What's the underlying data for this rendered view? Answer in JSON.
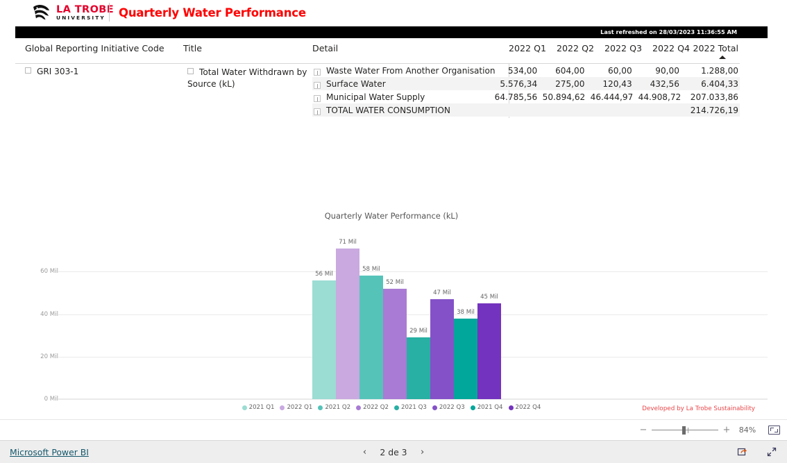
{
  "header": {
    "logo_main": "LA TROBE",
    "logo_sub": "UNIVERSITY",
    "title": "Quarterly Water Performance",
    "refresh_text": "Last refreshed on 28/03/2023 11:36:55 AM",
    "title_color": "#FF0000",
    "brand_red": "#E4002B"
  },
  "matrix": {
    "columns": [
      "Global Reporting Initiative Code",
      "Title",
      "Detail",
      "2022 Q1",
      "2022 Q2",
      "2022 Q3",
      "2022 Q4",
      "2022 Total"
    ],
    "sorted_column": "2022 Total",
    "sort_direction": "ascending",
    "gri_code": "GRI 303-1",
    "title_value": "Total Water Withdrawn by Source (kL)",
    "rows": [
      {
        "detail": "Waste Water From Another Organisation",
        "q1": "534,00",
        "q2": "604,00",
        "q3": "60,00",
        "q4": "90,00",
        "total": "1.288,00"
      },
      {
        "detail": "Surface Water",
        "q1": "5.576,34",
        "q2": "275,00",
        "q3": "120,43",
        "q4": "432,56",
        "total": "6.404,33"
      },
      {
        "detail": "Municipal Water Supply",
        "q1": "64.785,56",
        "q2": "50.894,62",
        "q3": "46.444,97",
        "q4": "44.908,72",
        "total": "207.033,86"
      },
      {
        "detail": "TOTAL WATER CONSUMPTION",
        "q1": "",
        "q2": "",
        "q3": "",
        "q4": "",
        "total": "214.726,19"
      }
    ]
  },
  "chart_data": {
    "type": "bar",
    "title": "Quarterly Water Performance (kL)",
    "xlabel": "",
    "ylabel": "",
    "ylim": [
      0,
      80000000
    ],
    "yticks": [
      "0 Mil",
      "20 Mil",
      "40 Mil",
      "60 Mil"
    ],
    "ytick_values": [
      0,
      20000000,
      40000000,
      60000000
    ],
    "grid": true,
    "legend_position": "bottom",
    "categories": [
      "2021 Q1",
      "2022 Q1",
      "2021 Q2",
      "2022 Q2",
      "2021 Q3",
      "2022 Q3",
      "2021 Q4",
      "2022 Q4"
    ],
    "values": [
      56,
      71,
      58,
      52,
      29,
      47,
      38,
      45
    ],
    "value_labels": [
      "56 Mil",
      "71 Mil",
      "58 Mil",
      "52 Mil",
      "29 Mil",
      "47 Mil",
      "38 Mil",
      "45 Mil"
    ],
    "colors": [
      "#9BDCD3",
      "#C9A9E0",
      "#56C3B9",
      "#A97BD4",
      "#27B0A3",
      "#8451C8",
      "#00A79A",
      "#7433BE"
    ]
  },
  "chart_footer": {
    "developed_by": "Developed by La Trobe Sustainability"
  },
  "zoombar": {
    "minus": "−",
    "plus": "+",
    "percent": "84%",
    "fit_icon": "fit-to-page-icon"
  },
  "bottombar": {
    "powerbi_link": "Microsoft Power BI",
    "prev": "‹",
    "next": "›",
    "page_text": "2 de 3",
    "share_icon": "share-icon",
    "fullscreen_icon": "fullscreen-icon"
  }
}
